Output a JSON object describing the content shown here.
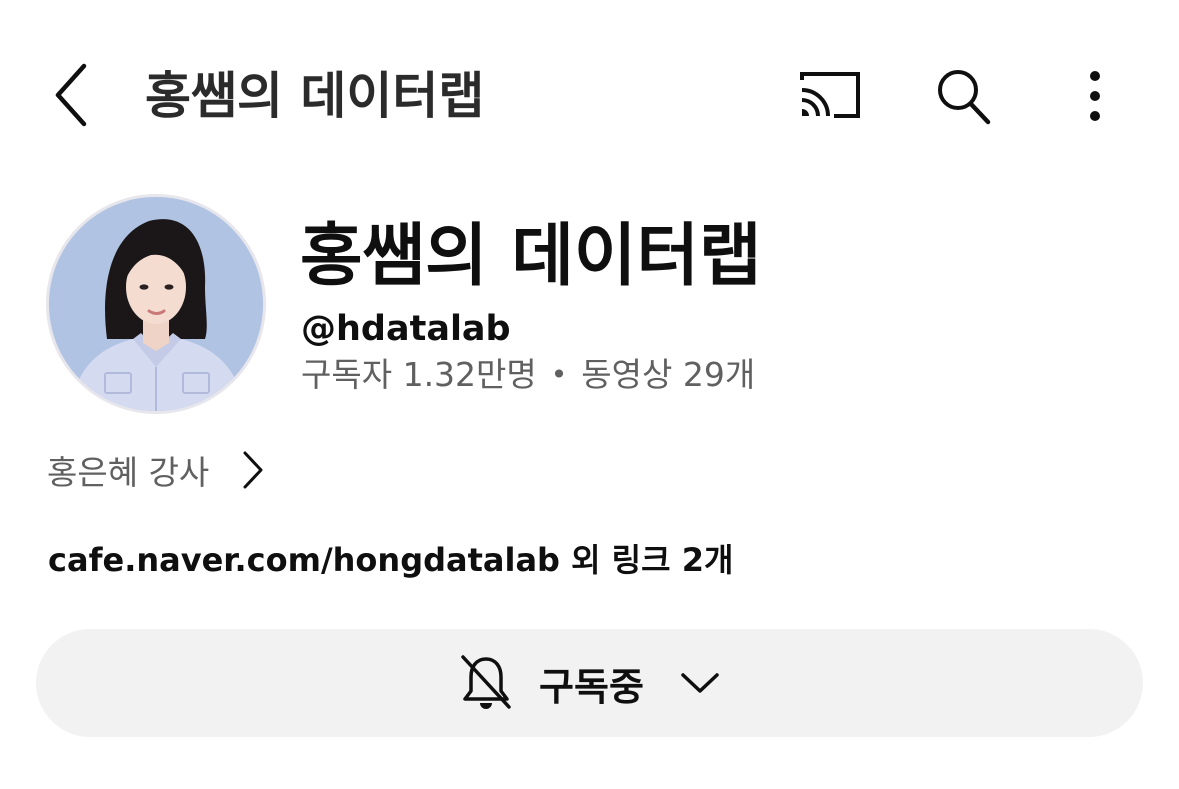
{
  "topbar": {
    "title": "홍쌤의 데이터랩",
    "icons": [
      "back-arrow-icon",
      "cast-icon",
      "search-icon",
      "more-vertical-icon"
    ]
  },
  "channel": {
    "name": "홍쌤의 데이터랩",
    "handle": "@hdatalab",
    "subscribers": "구독자 1.32만명",
    "separator": "•",
    "videos": "동영상 29개"
  },
  "owner": {
    "label": "홍은혜 강사"
  },
  "links": {
    "text": "cafe.naver.com/hongdatalab 외 링크 2개"
  },
  "subscribe": {
    "label": "구독중",
    "icon": "bell-off-icon"
  },
  "colors": {
    "background": "#ffffff",
    "text_primary": "#0f0f0f",
    "text_secondary": "#606060",
    "button_bg": "#f2f2f2",
    "avatar_bg": "#a9bde0"
  }
}
